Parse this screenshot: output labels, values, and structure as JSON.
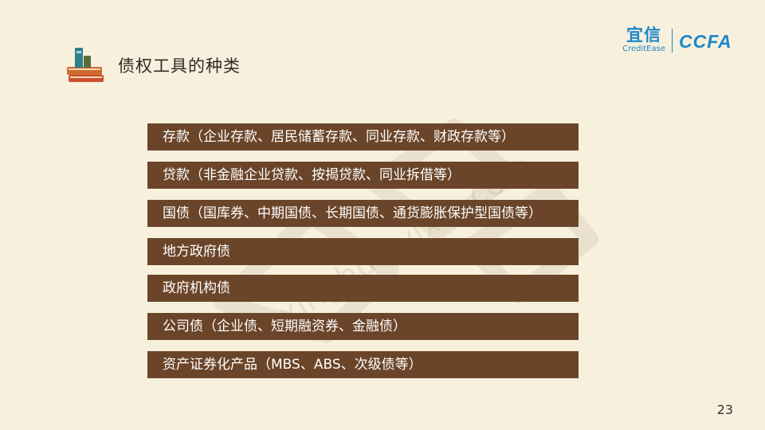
{
  "slide": {
    "title": "债权工具的种类",
    "page_number": "23",
    "background": "#f7f0dd",
    "bar_color": "#6b4529"
  },
  "logo": {
    "cn_text": "宜信",
    "en_text": "CreditEase",
    "partner": "CCFA",
    "color": "#1e88c8"
  },
  "title_icon": "stacked-books-icon",
  "items": [
    "存款（企业存款、居民储蓄存款、同业存款、财政存款等）",
    "贷款（非金融企业贷款、按揭贷款、同业拆借等）",
    "国债（国库券、中期国债、长期国债、通货膨胀保护型国债等）",
    "地方政府债",
    "政府机构债",
    "公司债（企业债、短期融资券、金融债）",
    "资产证券化产品（MBS、ABS、次级债等）"
  ],
  "watermark": {
    "site": "xinghuo.yixin.com"
  }
}
